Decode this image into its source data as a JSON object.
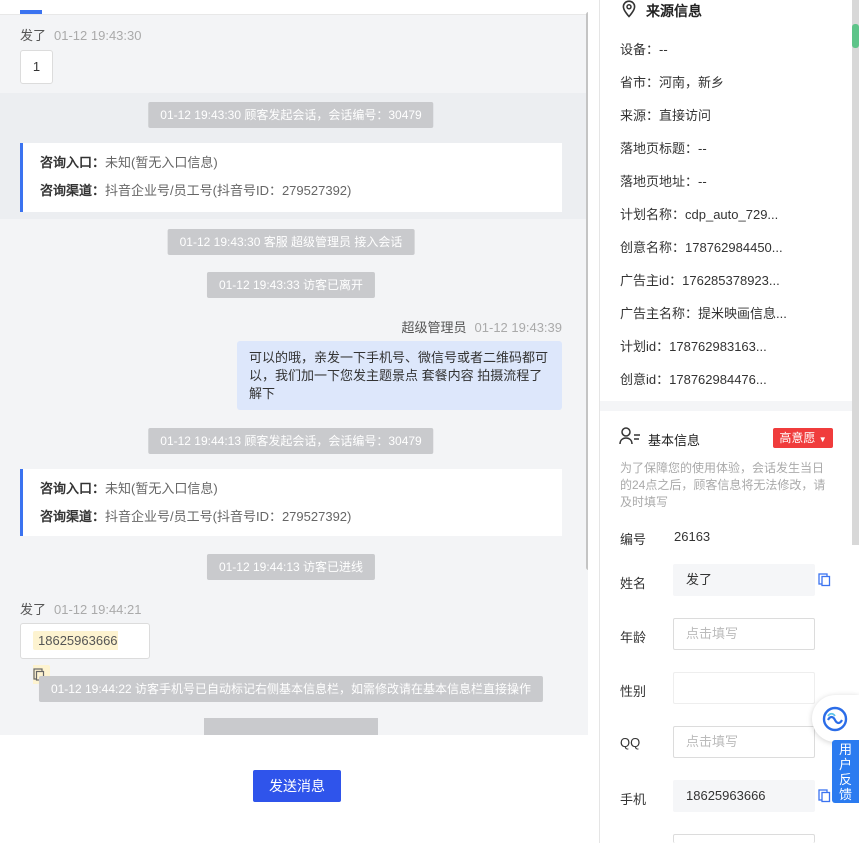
{
  "chat": {
    "msg1": {
      "sender": "发了",
      "time": "01-12 19:43:30",
      "text": "1"
    },
    "sys1": "01-12 19:43:30 顾客发起会话，会话编号：30479",
    "card1": {
      "entry_label": "咨询入口：",
      "entry_value": "未知(暂无入口信息)",
      "channel_label": "咨询渠道：",
      "channel_value": "抖音企业号/员工号(抖音号ID：279527392)"
    },
    "sys2": "01-12 19:43:30 客服 超级管理员 接入会话",
    "sys3": "01-12 19:43:33 访客已离开",
    "agent_msg": {
      "sender": "超级管理员",
      "time": "01-12 19:43:39",
      "text": "可以的哦，亲发一下手机号、微信号或者二维码都可以，我们加一下您发主题景点 套餐内容 拍摄流程了解下"
    },
    "sys4": "01-12 19:44:13 顾客发起会话，会话编号：30479",
    "card2": {
      "entry_label": "咨询入口：",
      "entry_value": "未知(暂无入口信息)",
      "channel_label": "咨询渠道：",
      "channel_value": "抖音企业号/员工号(抖音号ID：279527392)"
    },
    "sys5": "01-12 19:44:13 访客已进线",
    "msg2": {
      "sender": "发了",
      "time": "01-12 19:44:21",
      "phone": "18625963666"
    },
    "sys6": "01-12 19:44:22 访客手机号已自动标记右侧基本信息栏，如需修改请在基本信息栏直接操作",
    "send_label": "发送消息"
  },
  "source": {
    "title": "来源信息",
    "rows": [
      {
        "label": "设备：",
        "value": "--"
      },
      {
        "label": "省市：",
        "value": "河南，新乡"
      },
      {
        "label": "来源：",
        "value": "直接访问"
      },
      {
        "label": "落地页标题：",
        "value": "--"
      },
      {
        "label": "落地页地址：",
        "value": "--"
      },
      {
        "label": "计划名称：",
        "value": "cdp_auto_729..."
      },
      {
        "label": "创意名称：",
        "value": "178762984450..."
      },
      {
        "label": "广告主id：",
        "value": "176285378923..."
      },
      {
        "label": "广告主名称：",
        "value": "提米映画信息..."
      },
      {
        "label": "计划id：",
        "value": "178762983163..."
      },
      {
        "label": "创意id：",
        "value": "178762984476..."
      }
    ]
  },
  "basic": {
    "title": "基本信息",
    "intent": "高意愿",
    "note": "为了保障您的使用体验，会话发生当日的24点之后，顾客信息将无法修改，请及时填写",
    "id_label": "编号",
    "id_value": "26163",
    "name_label": "姓名",
    "name_value": "发了",
    "age_label": "年龄",
    "age_placeholder": "点击填写",
    "gender_label": "性别",
    "qq_label": "QQ",
    "qq_placeholder": "点击填写",
    "phone_label": "手机",
    "phone_value": "18625963666"
  },
  "feedback": "用户反馈",
  "colors": {
    "accent": "#2f54eb",
    "badge": "#f03c3c",
    "card_border": "#3b73f0",
    "out_bubble": "#dde7fb"
  }
}
